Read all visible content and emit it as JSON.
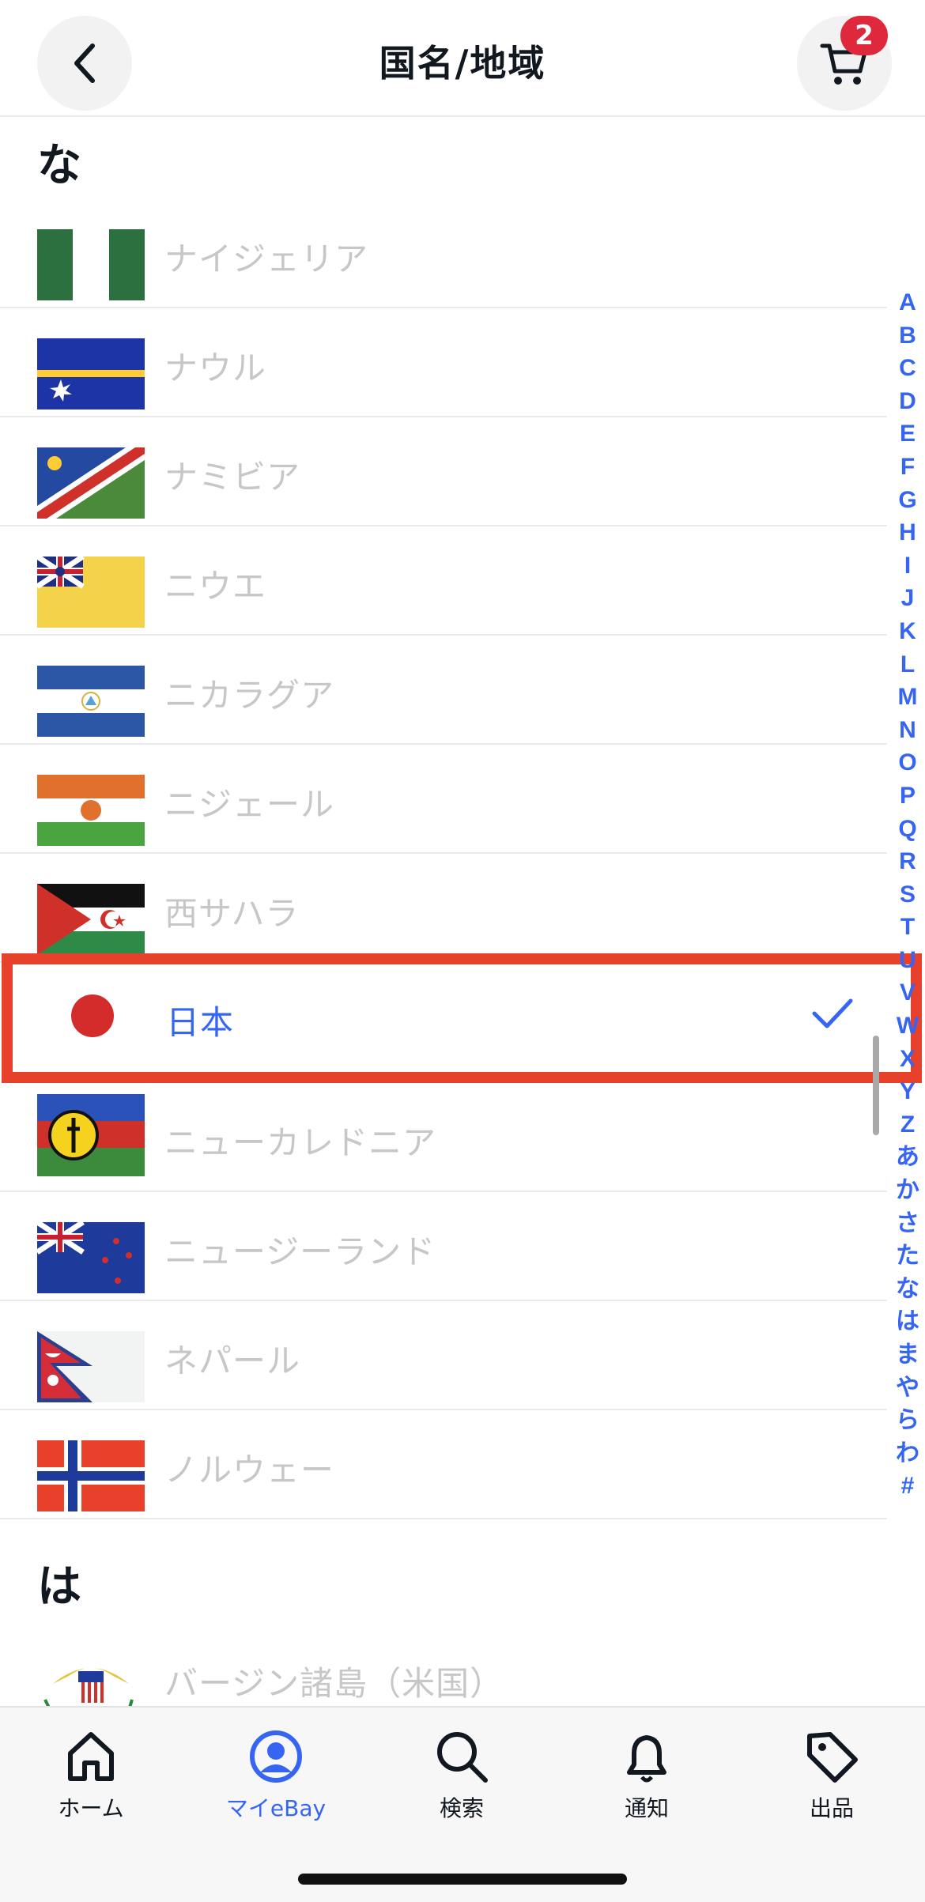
{
  "header": {
    "title": "国名/地域",
    "cart_count": "2"
  },
  "sections": [
    {
      "heading": "な"
    },
    {
      "heading": "は"
    }
  ],
  "countries": [
    {
      "label": "ナイジェリア",
      "flag": "nigeria-flag"
    },
    {
      "label": "ナウル",
      "flag": "nauru-flag"
    },
    {
      "label": "ナミビア",
      "flag": "namibia-flag"
    },
    {
      "label": "ニウエ",
      "flag": "niue-flag"
    },
    {
      "label": "ニカラグア",
      "flag": "nicaragua-flag"
    },
    {
      "label": "ニジェール",
      "flag": "niger-flag"
    },
    {
      "label": "西サハラ",
      "flag": "western-sahara-flag"
    },
    {
      "label": "日本",
      "flag": "japan-flag",
      "selected": true
    },
    {
      "label": "ニューカレドニア",
      "flag": "new-caledonia-flag"
    },
    {
      "label": "ニュージーランド",
      "flag": "new-zealand-flag"
    },
    {
      "label": "ネパール",
      "flag": "nepal-flag"
    },
    {
      "label": "ノルウェー",
      "flag": "norway-flag"
    },
    {
      "label": "バージン諸島（米国）",
      "flag": "us-virgin-islands-flag"
    }
  ],
  "index": [
    "A",
    "B",
    "C",
    "D",
    "E",
    "F",
    "G",
    "H",
    "I",
    "J",
    "K",
    "L",
    "M",
    "N",
    "O",
    "P",
    "Q",
    "R",
    "S",
    "T",
    "U",
    "V",
    "W",
    "X",
    "Y",
    "Z",
    "あ",
    "か",
    "さ",
    "た",
    "な",
    "は",
    "ま",
    "や",
    "ら",
    "わ",
    "#"
  ],
  "bottom_nav": [
    {
      "label": "ホーム",
      "icon": "home-icon"
    },
    {
      "label": "マイeBay",
      "icon": "profile-icon",
      "active": true
    },
    {
      "label": "検索",
      "icon": "search-icon"
    },
    {
      "label": "通知",
      "icon": "bell-icon"
    },
    {
      "label": "出品",
      "icon": "tag-icon"
    }
  ],
  "colors": {
    "accent": "#3665f3",
    "highlight_border": "#e8412b",
    "badge": "#e0283c",
    "muted_text": "#c7c7c7"
  }
}
